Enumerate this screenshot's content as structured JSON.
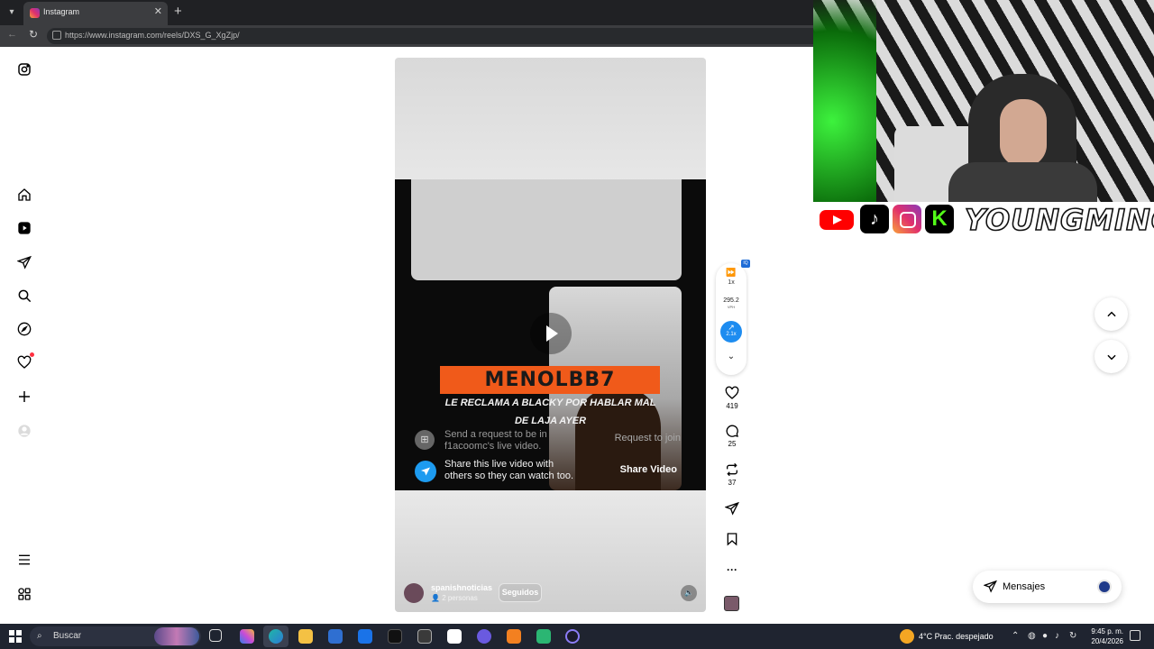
{
  "browser": {
    "tab_title": "Instagram",
    "tab_close": "✕",
    "new_tab": "+",
    "url": "https://www.instagram.com/reels/DXS_G_XgZjp/"
  },
  "reel": {
    "banner": "MENOLBB7",
    "caption_line1": "LE RECLAMA A BLACKY POR HABLAR MAL",
    "caption_line2": "DE LAJA AYER",
    "request_text_1": "Send a request to be in",
    "request_text_2": "f1acoomc's live video.",
    "request_button": "Request to join",
    "share_text_1": "Share this live video with",
    "share_text_2": "others so they can watch too.",
    "share_button": "Share Video",
    "account_name": "spanishnoticias",
    "account_sub": "2 personas",
    "follow_label": "Seguidos"
  },
  "extension": {
    "badge": "IQ",
    "speed_label": "1x",
    "vph_value": "295.2",
    "vph_unit": "VPH",
    "multiplier": "2.1x"
  },
  "actions": {
    "likes": "419",
    "comments": "25",
    "reposts": "37",
    "more": "···"
  },
  "overlay": {
    "brand": "YOUNGMINOR",
    "tiktok_glyph": "♪",
    "kick_glyph": "K"
  },
  "messages": {
    "label": "Mensajes"
  },
  "taskbar": {
    "search_label": "Buscar",
    "weather": "4°C  Prac. despejado",
    "time": "9:45 p. m.",
    "date": "20/4/2026"
  },
  "colors": {
    "accent_blue": "#1d8cf0",
    "banner_orange": "#f05a1a",
    "notification_red": "#ff3040"
  }
}
